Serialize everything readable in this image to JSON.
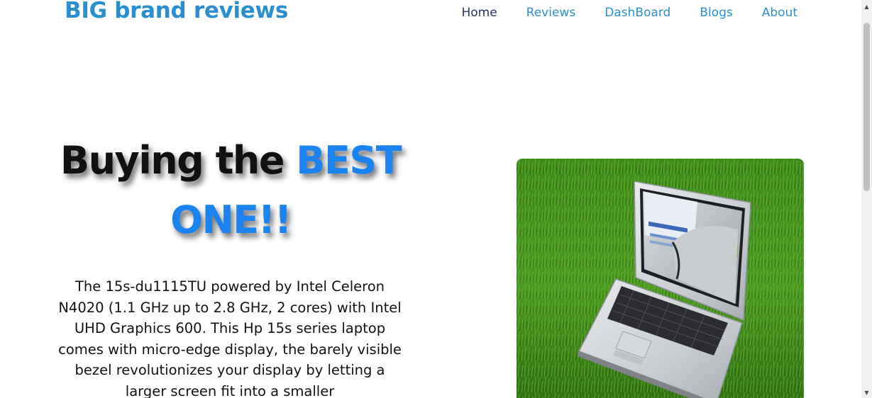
{
  "header": {
    "brand": "BIG brand reviews",
    "nav": [
      {
        "label": "Home",
        "active": true
      },
      {
        "label": "Reviews",
        "active": false
      },
      {
        "label": "DashBoard",
        "active": false
      },
      {
        "label": "Blogs",
        "active": false
      },
      {
        "label": "About",
        "active": false
      }
    ]
  },
  "hero": {
    "title_plain": "Buying the ",
    "title_accent": "BEST ONE!!",
    "description": "The 15s-du1115TU powered by Intel Celeron N4020 (1.1 GHz up to 2.8 GHz, 2 cores) with Intel UHD Graphics 600. This Hp 15s series laptop comes with micro-edge display, the barely visible bezel revolutionizes your display by letting a larger screen fit into a smaller"
  },
  "colors": {
    "brand": "#2a8fd0",
    "nav_active": "#263566",
    "accent": "#1a83f0",
    "text": "#111111"
  },
  "icons": {
    "scroll_up": "scroll-up-arrow-icon",
    "scroll_down": "scroll-down-arrow-icon"
  }
}
